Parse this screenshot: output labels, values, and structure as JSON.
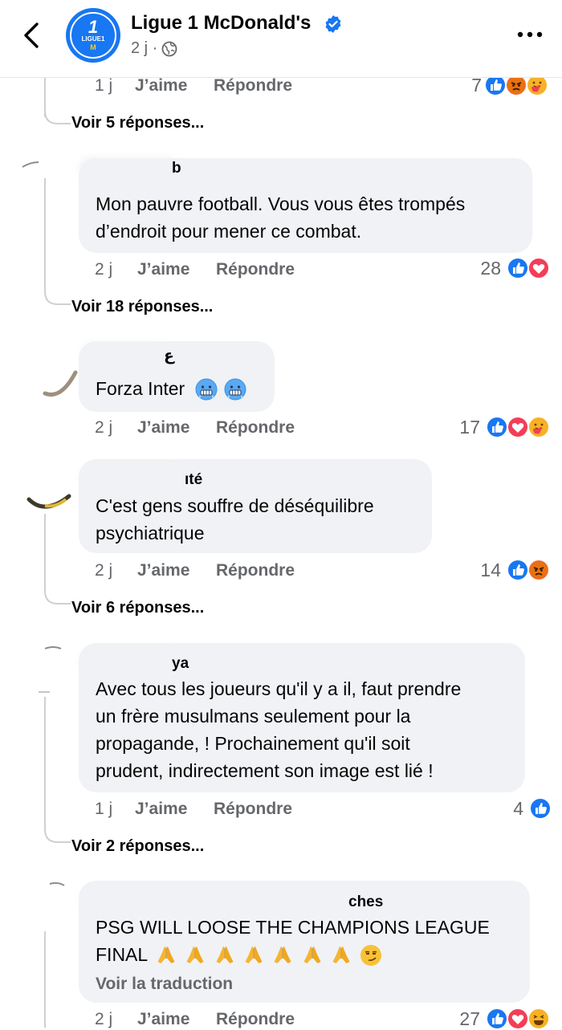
{
  "header": {
    "page_name": "Ligue 1 McDonald's",
    "time": "2 j ·",
    "logo_num": "1",
    "logo_text": "LIGUE1",
    "logo_m": "M",
    "icons": [
      "back-arrow-icon",
      "verified-badge-icon",
      "globe-icon",
      "more-icon"
    ]
  },
  "labels": {
    "like": "J’aime",
    "reply": "Répondre"
  },
  "comments": [
    {
      "time": "1 j",
      "reaction_count": "7",
      "reactions": [
        "like",
        "angry",
        "care"
      ],
      "view_replies": "Voir 5 réponses..."
    },
    {
      "name": "b",
      "text": [
        "Mon pauvre football. Vous vous êtes trompés",
        "d’endroit pour mener ce combat."
      ],
      "time": "2 j",
      "reaction_count": "28",
      "reactions": [
        "like",
        "love"
      ],
      "view_replies": "Voir 18 réponses..."
    },
    {
      "name": "ع",
      "text": [
        "Forza Inter"
      ],
      "time": "2 j",
      "reaction_count": "17",
      "reactions": [
        "like",
        "love",
        "care"
      ]
    },
    {
      "name": "ıté",
      "text": [
        "C'est gens souffre de déséquilibre",
        "psychiatrique"
      ],
      "time": "2 j",
      "reaction_count": "14",
      "reactions": [
        "like",
        "angry"
      ],
      "view_replies": "Voir 6 réponses..."
    },
    {
      "name": "ya",
      "text": [
        "Avec tous les joueurs qu'il y a il, faut prendre",
        "un frère musulmans seulement pour la",
        "propagande, ! Prochainement qu'il soit",
        "prudent, indirectement son image est lié !"
      ],
      "time": "1 j",
      "reaction_count": "4",
      "reactions": [
        "like"
      ],
      "view_replies": "Voir 2 réponses..."
    },
    {
      "name": "ches",
      "text": [
        "PSG WILL LOOSE THE CHAMPIONS LEAGUE",
        "FINAL"
      ],
      "translate": "Voir la traduction",
      "time": "2 j",
      "reaction_count": "27",
      "reactions": [
        "like",
        "love",
        "haha"
      ]
    }
  ],
  "colors": {
    "accent": "#1877f2",
    "love": "#f33e58",
    "angry": "#e9710f",
    "muted": "#65676b",
    "bubble": "#f0f2f5"
  }
}
